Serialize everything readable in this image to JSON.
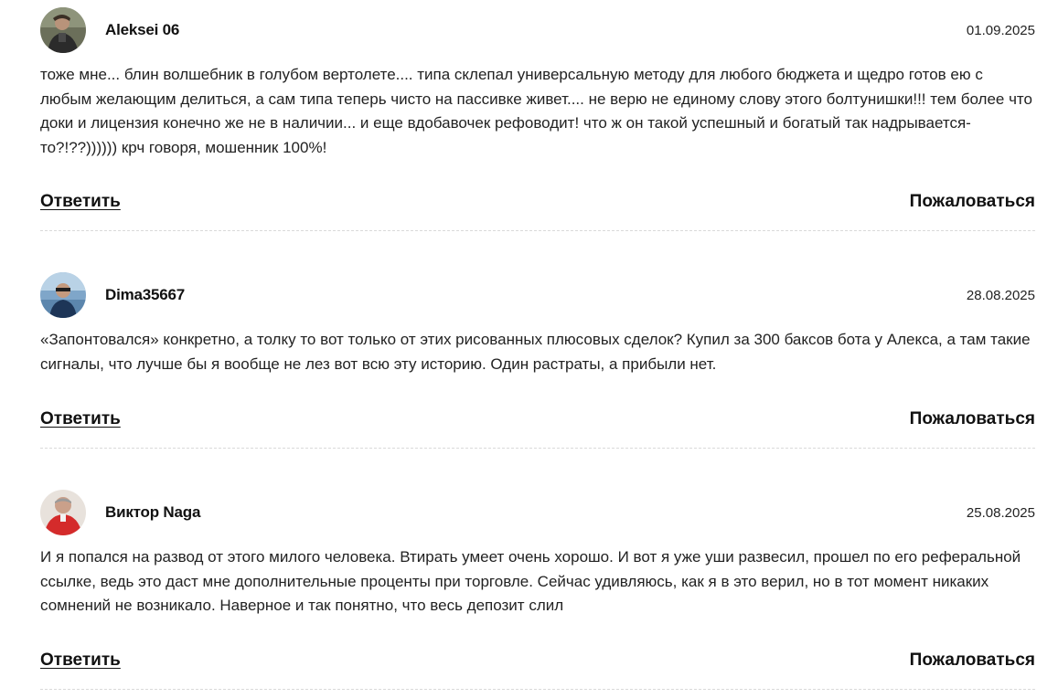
{
  "comments": [
    {
      "author": "Aleksei 06",
      "date": "01.09.2025",
      "text": "тоже мне... блин волшебник в голубом вертолете.... типа склепал универсальную методу для любого бюджета и щедро готов ею с любым желающим делиться, а сам типа теперь чисто на пассивке живет.... не верю не единому слову этого болтунишки!!! тем более что доки и лицензия конечно же не в наличии... и еще вдобавочек рефоводит! что ж он такой успешный и богатый так надрывается-то?!??)))))) крч говоря, мошенник 100%!",
      "reply_label": "Ответить",
      "report_label": "Пожаловаться",
      "avatar_icon": "user-avatar-photo"
    },
    {
      "author": "Dima35667",
      "date": "28.08.2025",
      "text": "«Запонтовался» конкретно, а толку то вот только от этих рисованных плюсовых сделок? Купил за 300 баксов бота у Алекса, а там такие сигналы, что лучше бы я вообще не лез вот всю эту историю. Один растраты, а прибыли нет.",
      "reply_label": "Ответить",
      "report_label": "Пожаловаться",
      "avatar_icon": "user-avatar-photo"
    },
    {
      "author": "Виктор Naga",
      "date": "25.08.2025",
      "text": "И я попался на развод от этого милого человека. Втирать умеет очень хорошо. И вот я уже уши развесил, прошел по его реферальной ссылке, ведь это даст мне дополнительные проценты при торговле. Сейчас удивляюсь, как я в это верил, но в тот момент никаких сомнений не возникало. Наверное и так понятно, что весь депозит слил",
      "reply_label": "Ответить",
      "report_label": "Пожаловаться",
      "avatar_icon": "user-avatar-photo"
    }
  ]
}
